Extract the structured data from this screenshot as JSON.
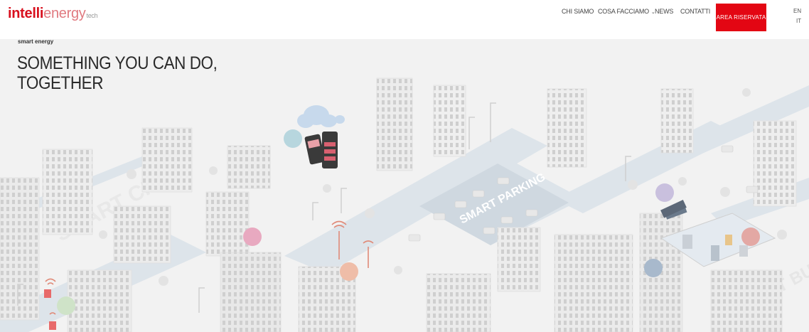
{
  "brand": {
    "logo_part1": "intelli",
    "logo_part2": "energy",
    "logo_part3": "tech",
    "accent": "#e30613"
  },
  "nav": {
    "items": [
      {
        "label": "CHI SIAMO"
      },
      {
        "label": "COSA FACCIAMO",
        "has_dropdown": true
      },
      {
        "label": "NEWS"
      },
      {
        "label": "CONTATTI"
      }
    ],
    "cta_label": "AREA RISERVATA",
    "languages": [
      "EN",
      "IT"
    ]
  },
  "hero": {
    "tagline": "smart energy",
    "headline_line1": "SOMETHING YOU CAN DO,",
    "headline_line2": "TOGETHER",
    "illustration_labels": [
      "SMART CITY",
      "SMART PARKING",
      "SMART BUILDING"
    ],
    "illustration": "isometric smart city"
  }
}
